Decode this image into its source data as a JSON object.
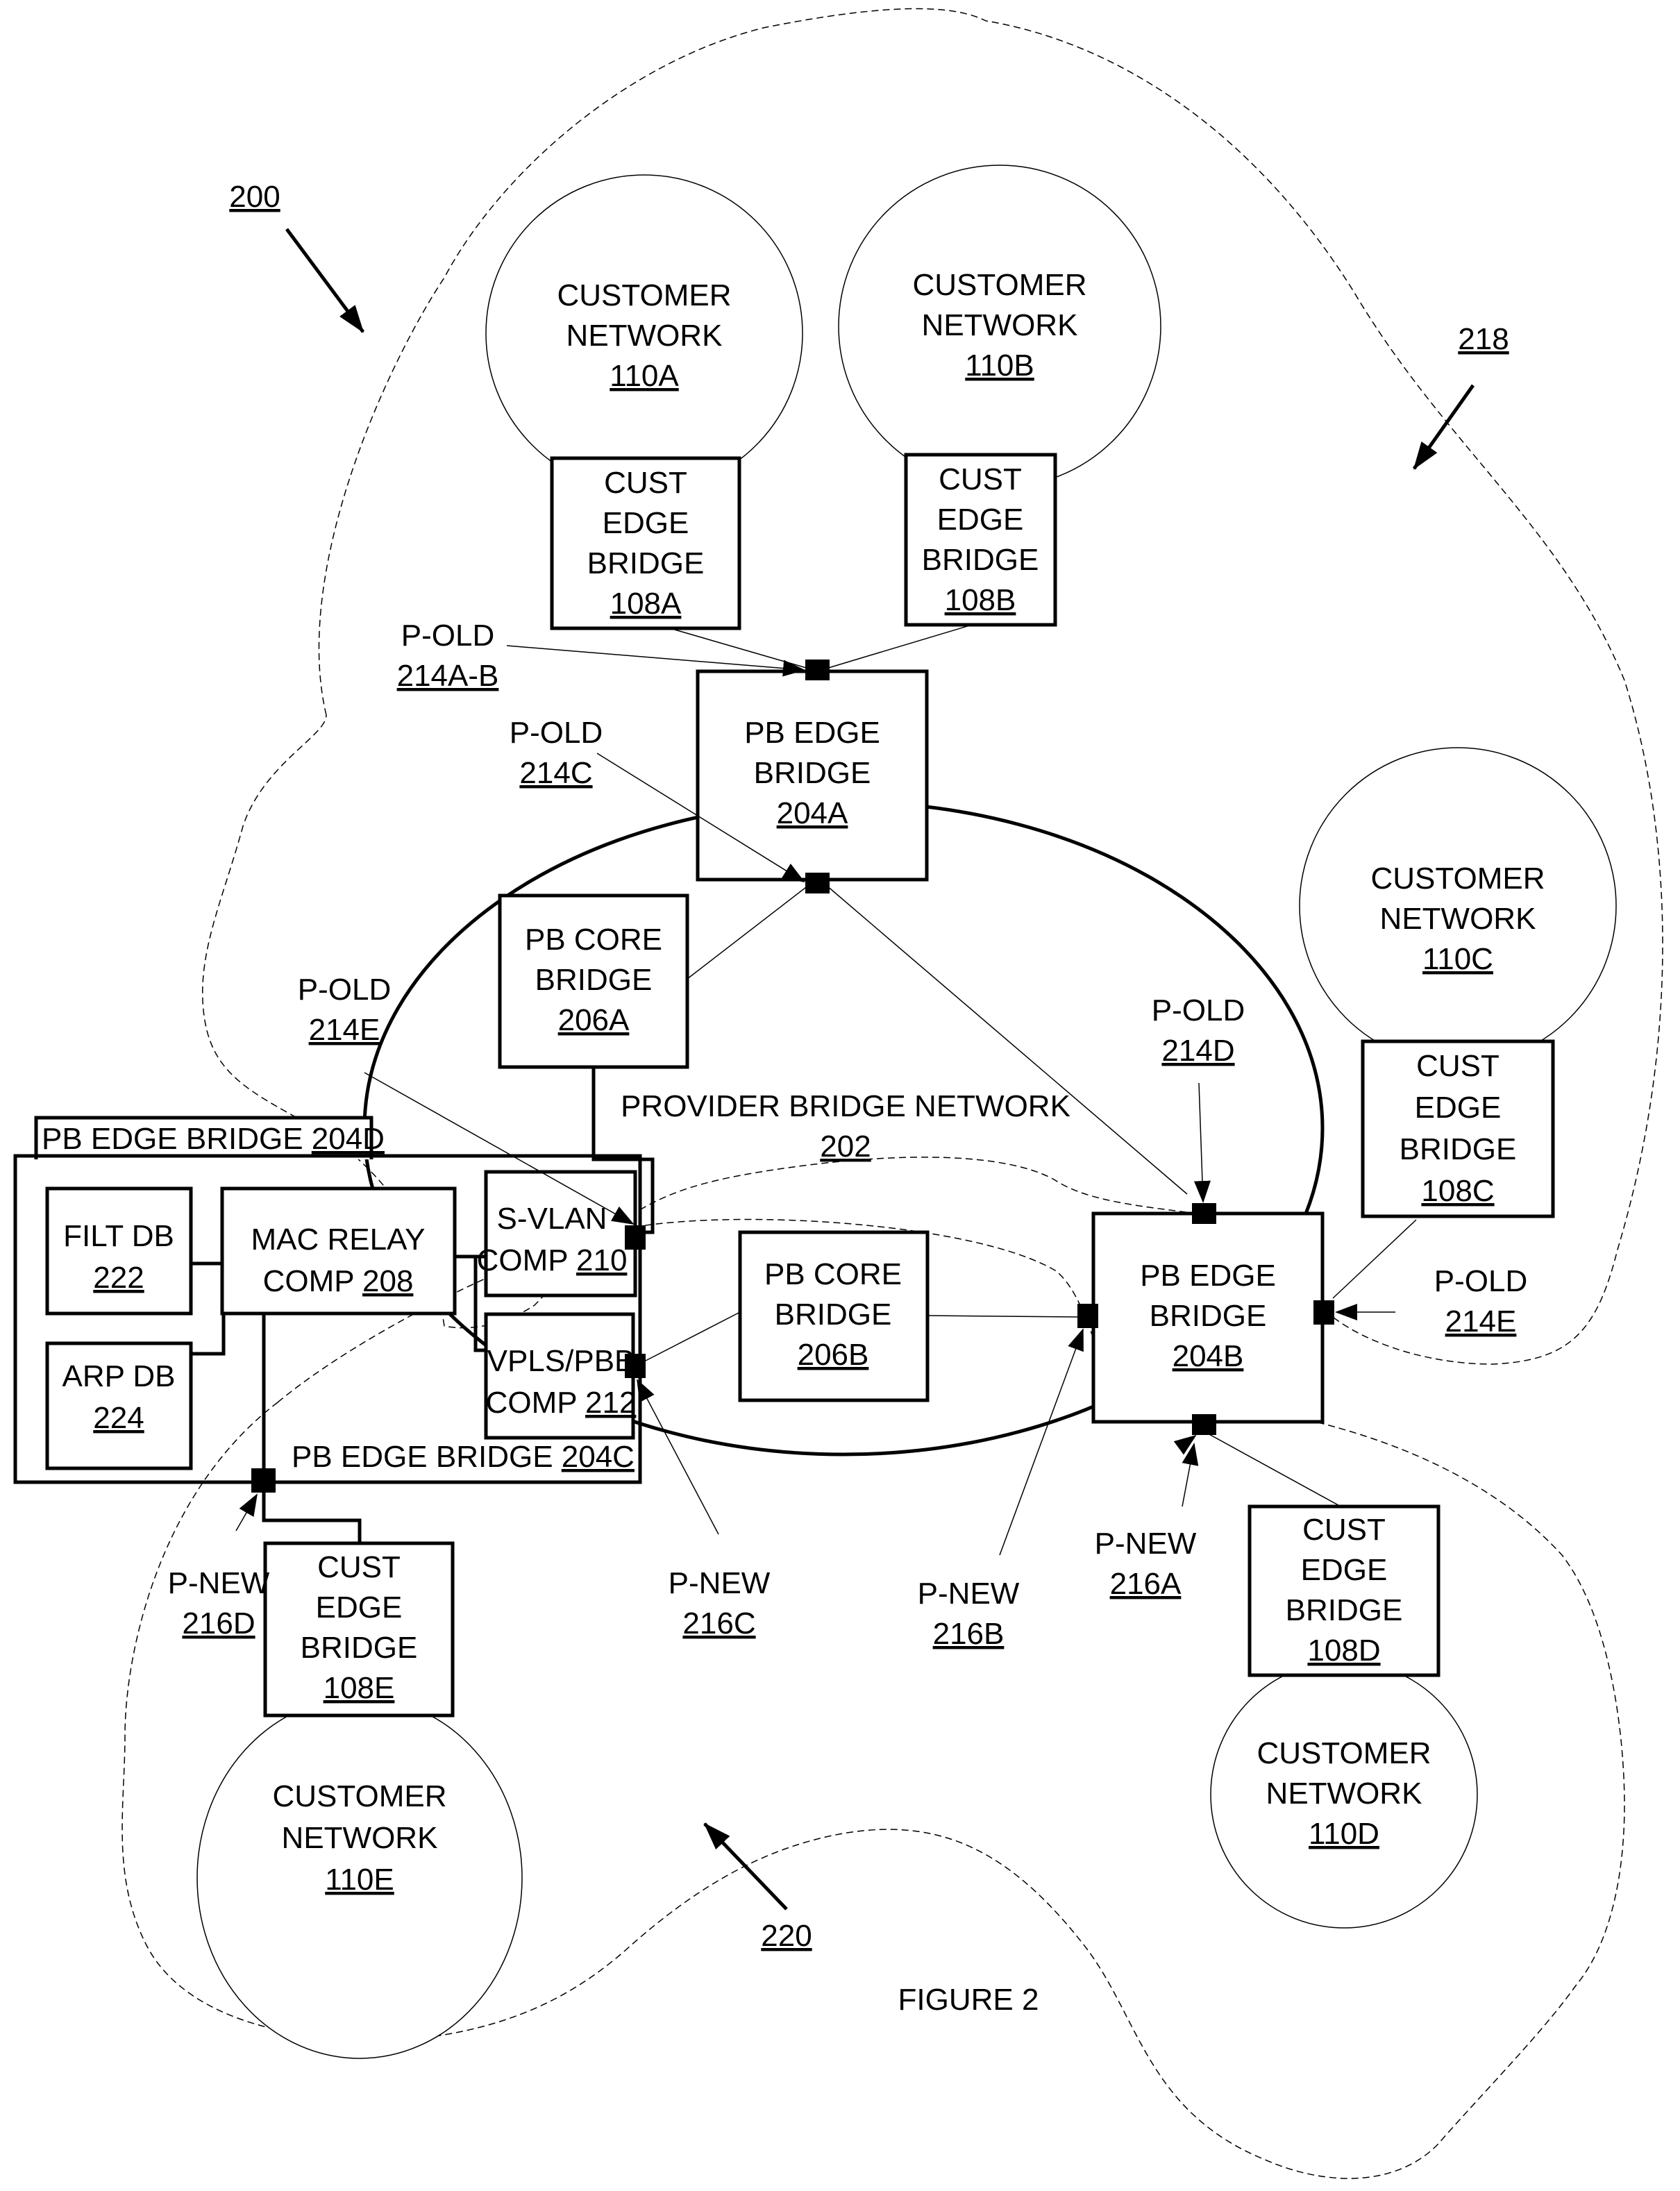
{
  "figure": {
    "title": "FIGURE 2",
    "ref_200": "200",
    "ref_218": "218",
    "ref_220": "220"
  },
  "customer_networks": [
    {
      "id": "110A",
      "line1": "CUSTOMER",
      "line2": "NETWORK",
      "ref": "110A"
    },
    {
      "id": "110B",
      "line1": "CUSTOMER",
      "line2": "NETWORK",
      "ref": "110B"
    },
    {
      "id": "110C",
      "line1": "CUSTOMER",
      "line2": "NETWORK",
      "ref": "110C"
    },
    {
      "id": "110D",
      "line1": "CUSTOMER",
      "line2": "NETWORK",
      "ref": "110D"
    },
    {
      "id": "110E",
      "line1": "CUSTOMER",
      "line2": "NETWORK",
      "ref": "110E"
    }
  ],
  "cust_edge_bridges": [
    {
      "l1": "CUST",
      "l2": "EDGE",
      "l3": "BRIDGE",
      "ref": "108A"
    },
    {
      "l1": "CUST",
      "l2": "EDGE",
      "l3": "BRIDGE",
      "ref": "108B"
    },
    {
      "l1": "CUST",
      "l2": "EDGE",
      "l3": "BRIDGE",
      "ref": "108C"
    },
    {
      "l1": "CUST",
      "l2": "EDGE",
      "l3": "BRIDGE",
      "ref": "108D"
    },
    {
      "l1": "CUST",
      "l2": "EDGE",
      "l3": "BRIDGE",
      "ref": "108E"
    }
  ],
  "pb_edge_bridges": {
    "a": {
      "l1": "PB EDGE",
      "l2": "BRIDGE",
      "ref": "204A"
    },
    "b": {
      "l1": "PB EDGE",
      "l2": "BRIDGE",
      "ref": "204B"
    },
    "c": {
      "label": "PB EDGE BRIDGE ",
      "ref": "204C"
    },
    "d": {
      "label": "PB EDGE BRIDGE ",
      "ref": "204D"
    }
  },
  "pb_core_bridges": {
    "a": {
      "l1": "PB CORE",
      "l2": "BRIDGE",
      "ref": "206A"
    },
    "b": {
      "l1": "PB CORE",
      "l2": "BRIDGE",
      "ref": "206B"
    }
  },
  "provider_network": {
    "label": "PROVIDER BRIDGE NETWORK",
    "ref": "202"
  },
  "components": {
    "filt_db": {
      "l1": "FILT DB",
      "ref": "222"
    },
    "arp_db": {
      "l1": "ARP DB",
      "ref": "224"
    },
    "mac_relay": {
      "l1": "MAC RELAY",
      "l2": "COMP ",
      "ref": "208"
    },
    "svlan": {
      "l1": "S-VLAN",
      "l2": "COMP ",
      "ref": "210"
    },
    "vpls": {
      "l1": "VPLS/PBB",
      "l2": "COMP ",
      "ref": "212"
    }
  },
  "ports": {
    "p214ab": {
      "name": "P-OLD",
      "ref": "214A-B"
    },
    "p214c": {
      "name": "P-OLD",
      "ref": "214C"
    },
    "p214d": {
      "name": "P-OLD",
      "ref": "214D"
    },
    "p214e_left": {
      "name": "P-OLD",
      "ref": "214E"
    },
    "p214e_right": {
      "name": "P-OLD",
      "ref": "214E"
    },
    "p216a": {
      "name": "P-NEW",
      "ref": "216A"
    },
    "p216b": {
      "name": "P-NEW",
      "ref": "216B"
    },
    "p216c": {
      "name": "P-NEW",
      "ref": "216C"
    },
    "p216d": {
      "name": "P-NEW",
      "ref": "216D"
    }
  }
}
